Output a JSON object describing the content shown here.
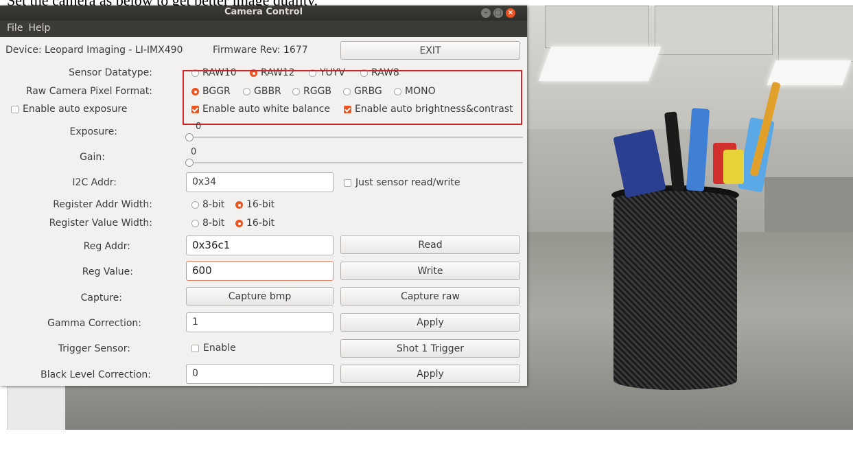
{
  "doc_caption": "Set the camera as below to get better image quality.",
  "window": {
    "title": "Camera Control",
    "menu": [
      "File",
      "Help"
    ]
  },
  "device": {
    "name": "Device: Leopard Imaging - LI-IMX490",
    "firmware": "Firmware Rev: 1677",
    "exit_label": "EXIT"
  },
  "sensor_datatype": {
    "label": "Sensor Datatype:",
    "options": [
      "RAW10",
      "RAW12",
      "YUYV",
      "RAW8"
    ],
    "selected": "RAW12"
  },
  "pixel_format": {
    "label": "Raw Camera Pixel Format:",
    "options": [
      "BGGR",
      "GBBR",
      "RGGB",
      "GRBG",
      "MONO"
    ],
    "selected": "BGGR"
  },
  "auto": {
    "exposure_label": "Enable auto exposure",
    "exposure_checked": false,
    "white_balance_label": "Enable auto white balance",
    "white_balance_checked": true,
    "brightness_label": "Enable auto brightness&contrast",
    "brightness_checked": true
  },
  "exposure": {
    "label": "Exposure:",
    "value": "0"
  },
  "gain": {
    "label": "Gain:",
    "value": "0"
  },
  "i2c": {
    "label": "I2C Addr:",
    "value": "0x34",
    "just_sensor_label": "Just sensor read/write",
    "just_sensor_checked": false
  },
  "reg_addr_width": {
    "label": "Register Addr Width:",
    "options": [
      "8-bit",
      "16-bit"
    ],
    "selected": "16-bit"
  },
  "reg_value_width": {
    "label": "Register Value Width:",
    "options": [
      "8-bit",
      "16-bit"
    ],
    "selected": "16-bit"
  },
  "reg_addr": {
    "label": "Reg Addr:",
    "value": "0x36c1",
    "button": "Read"
  },
  "reg_value": {
    "label": "Reg Value:",
    "value": "600",
    "button": "Write"
  },
  "capture": {
    "label": "Capture:",
    "bmp_button": "Capture bmp",
    "raw_button": "Capture raw"
  },
  "gamma": {
    "label": "Gamma Correction:",
    "value": "1",
    "button": "Apply"
  },
  "trigger": {
    "label": "Trigger Sensor:",
    "enable_label": "Enable",
    "enable_checked": false,
    "button": "Shot 1 Trigger"
  },
  "black_level": {
    "label": "Black Level Correction:",
    "value": "0",
    "button": "Apply"
  },
  "colors": {
    "accent": "#e95420",
    "highlight_box": "#d0262a",
    "titlebar": "#3c3b37"
  }
}
